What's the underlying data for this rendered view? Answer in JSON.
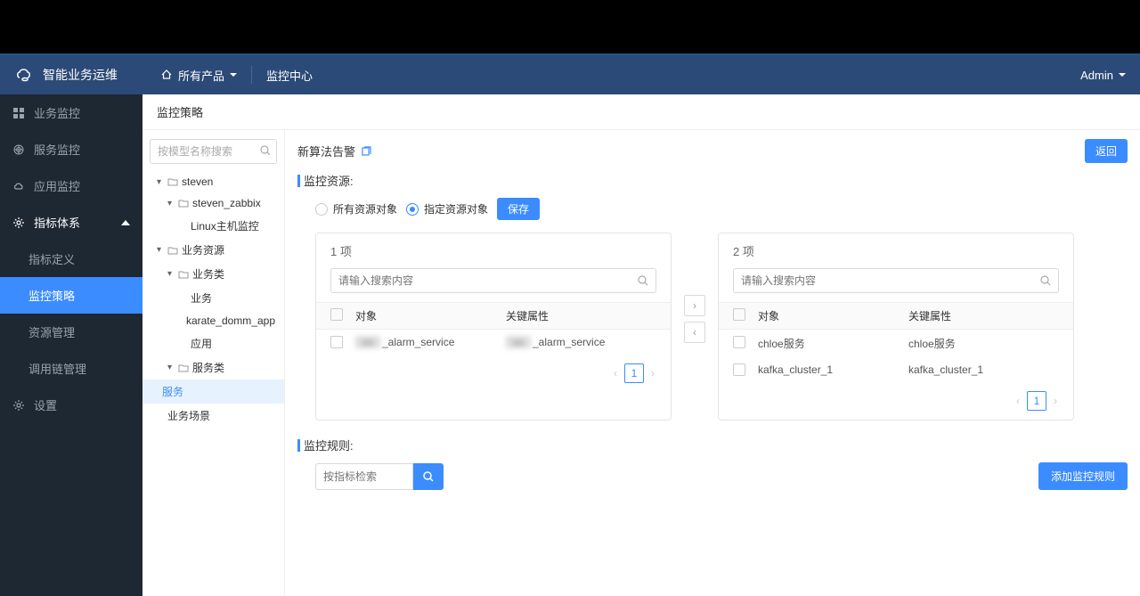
{
  "header": {
    "logo_text": "智能业务运维",
    "all_products": "所有产品",
    "monitor_center": "监控中心",
    "user": "Admin"
  },
  "sidebar": {
    "items": [
      {
        "label": "业务监控",
        "icon": "grid"
      },
      {
        "label": "服务监控",
        "icon": "radar"
      },
      {
        "label": "应用监控",
        "icon": "cloud"
      },
      {
        "label": "指标体系",
        "icon": "gear",
        "expanded": true,
        "children": [
          {
            "label": "指标定义"
          },
          {
            "label": "监控策略",
            "active": true
          },
          {
            "label": "资源管理"
          },
          {
            "label": "调用链管理"
          }
        ]
      },
      {
        "label": "设置",
        "icon": "cog"
      }
    ]
  },
  "content": {
    "title": "监控策略",
    "tree_search_placeholder": "按模型名称搜索",
    "tree": [
      {
        "label": "steven",
        "type": "folder",
        "indent": 1,
        "caret": "down"
      },
      {
        "label": "steven_zabbix",
        "type": "folder",
        "indent": 2,
        "caret": "down"
      },
      {
        "label": "Linux主机监控",
        "type": "leaf",
        "indent": 3
      },
      {
        "label": "业务资源",
        "type": "folder",
        "indent": 1,
        "caret": "down"
      },
      {
        "label": "业务类",
        "type": "folder",
        "indent": 2,
        "caret": "down"
      },
      {
        "label": "业务",
        "type": "leaf",
        "indent": 3
      },
      {
        "label": "karate_domm_app",
        "type": "leaf",
        "indent": 3
      },
      {
        "label": "应用",
        "type": "leaf",
        "indent": 3
      },
      {
        "label": "服务类",
        "type": "folder",
        "indent": 2,
        "caret": "down"
      },
      {
        "label": "服务",
        "type": "leaf",
        "indent": 3,
        "selected": true
      },
      {
        "label": "业务场景",
        "type": "leaf",
        "indent": 1
      }
    ],
    "panel": {
      "title": "新算法告警",
      "back": "返回",
      "section_resource": "监控资源:",
      "radio_all": "所有资源对象",
      "radio_specific": "指定资源对象",
      "save": "保存",
      "left_count": "1 项",
      "right_count": "2 项",
      "search_placeholder": "请输入搜索内容",
      "col_obj": "对象",
      "col_key": "关键属性",
      "left_rows": [
        {
          "obj": "_alarm_service",
          "key": "_alarm_service",
          "blurred": true
        }
      ],
      "right_rows": [
        {
          "obj": "chloe服务",
          "key": "chloe服务"
        },
        {
          "obj": "kafka_cluster_1",
          "key": "kafka_cluster_1"
        }
      ],
      "page": "1",
      "section_rule": "监控规则:",
      "rule_search_placeholder": "按指标检索",
      "add_rule": "添加监控规则"
    }
  }
}
